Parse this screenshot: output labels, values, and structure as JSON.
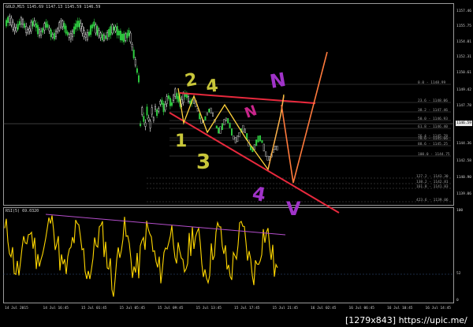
{
  "chart": {
    "symbol_header": "GOLD,M15  1145.69 1147.13 1145.59 1146.59",
    "rsi_header": "RSI(5) 69.0320",
    "current_price": "1146.59",
    "price_axis_labels": [
      "1157.46",
      "1155.75",
      "1154.01",
      "1152.31",
      "1150.61",
      "1149.42",
      "1147.78",
      "1146.59",
      "1144.36",
      "1142.58",
      "1140.90",
      "1139.06"
    ],
    "rsi_axis_labels": [
      "100",
      "52",
      "0"
    ],
    "time_labels": [
      "14 Jul 2015",
      "14 Jul 16:45",
      "15 Jul 01:45",
      "15 Jul 05:45",
      "15 Jul 09:45",
      "15 Jul 13:45",
      "15 Jul 17:45",
      "15 Jul 21:45",
      "16 Jul 02:45",
      "16 Jul 06:45",
      "16 Jul 10:45",
      "16 Jul 14:45"
    ],
    "fib_labels": [
      "0.0 - 1148.99",
      "23.6 - 1148.06",
      "38.2 - 1147.46",
      "50.0 - 1146.93",
      "61.8 - 1146.40",
      "76.4 - 1145.78",
      "78.6 - 1145.66",
      "88.6 - 1145.25",
      "100.0 - 1144.75",
      "127.2 - 1143.30",
      "138.2 - 1142.81",
      "161.8 - 1141.83",
      "423.6 - 1139.06"
    ],
    "annotations": {
      "yellow_digits": [
        "2",
        "4",
        "1",
        "3"
      ],
      "purple_letters": [
        "N",
        "V"
      ],
      "pink_marks": [
        "N",
        "4"
      ]
    },
    "colors": {
      "bull_candle": "#2ecc40",
      "bear_candle": "#ffffff",
      "rsi_line": "#ffd700",
      "divergence_line": "#b44ecb",
      "trend_line": "#e8293d",
      "projection_line": "#ff7a3c"
    }
  },
  "badge": {
    "text": "[1279x843] https://upic.me/"
  }
}
